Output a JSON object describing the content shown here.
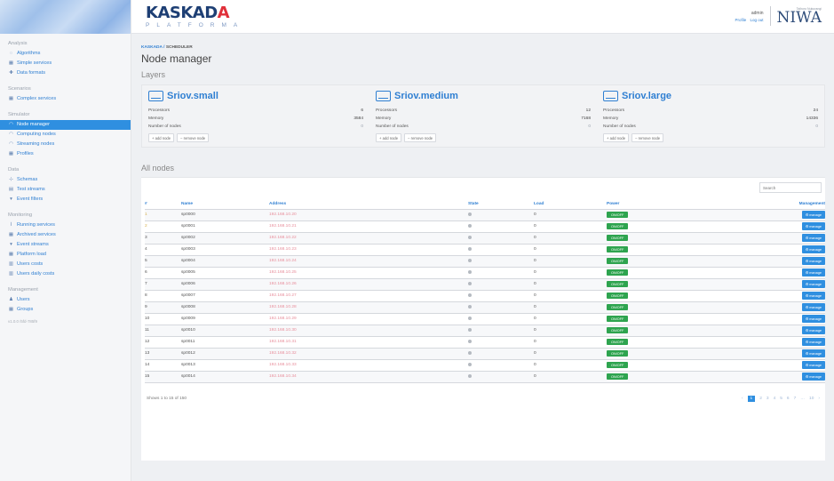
{
  "sidebar": {
    "sections": [
      {
        "title": "Analysis",
        "items": [
          {
            "icon": "spiral-icon",
            "glyph": "◌",
            "label": "Algorithms"
          },
          {
            "icon": "grid-icon",
            "glyph": "▦",
            "label": "Simple services"
          },
          {
            "icon": "pin-icon",
            "glyph": "✚",
            "label": "Data formats"
          }
        ]
      },
      {
        "title": "Scenarios",
        "items": [
          {
            "icon": "grid-icon",
            "glyph": "▦",
            "label": "Complex services"
          }
        ]
      },
      {
        "title": "Simulator",
        "items": [
          {
            "icon": "node-icon",
            "glyph": "◠",
            "label": "Node manager",
            "active": true
          },
          {
            "icon": "node-icon",
            "glyph": "◠",
            "label": "Computing nodes"
          },
          {
            "icon": "node-icon",
            "glyph": "◠",
            "label": "Streaming nodes"
          },
          {
            "icon": "grid-icon",
            "glyph": "▦",
            "label": "Profiles"
          }
        ]
      },
      {
        "title": "Data",
        "items": [
          {
            "icon": "tree-icon",
            "glyph": "⊹",
            "label": "Schemas"
          },
          {
            "icon": "table-icon",
            "glyph": "▤",
            "label": "Test streams"
          },
          {
            "icon": "filter-icon",
            "glyph": "▾",
            "label": "Event filters"
          }
        ]
      },
      {
        "title": "Monitoring",
        "items": [
          {
            "icon": "pulse-icon",
            "glyph": "⌇",
            "label": "Running services"
          },
          {
            "icon": "archive-icon",
            "glyph": "▦",
            "label": "Archived services"
          },
          {
            "icon": "filter-icon",
            "glyph": "▾",
            "label": "Event streams"
          },
          {
            "icon": "grid-icon",
            "glyph": "▦",
            "label": "Platform load"
          },
          {
            "icon": "bar-chart-icon",
            "glyph": "▥",
            "label": "Users costs"
          },
          {
            "icon": "bar-chart-icon",
            "glyph": "▥",
            "label": "Users daily costs"
          }
        ]
      },
      {
        "title": "Management",
        "items": [
          {
            "icon": "user-icon",
            "glyph": "♟",
            "label": "Users"
          },
          {
            "icon": "group-icon",
            "glyph": "▦",
            "label": "Groups"
          }
        ]
      }
    ],
    "version": "v1.0.0 /5fd-785f9"
  },
  "header": {
    "logo_word_main": "KASKAD",
    "logo_word_accent": "A",
    "logo_sub": "PLATFORMA",
    "user_name": "admin",
    "user_link_1": "Profile",
    "user_link_2": "Log out",
    "partner": "NIWA",
    "partner_sub": "Taihoro Nukurangi"
  },
  "main": {
    "breadcrumb": {
      "root": "KASKADA",
      "current": "SCHEDULER"
    },
    "title": "Node manager",
    "layers_title": "Layers",
    "layers": [
      {
        "name": "Sriov.small",
        "processors": "6",
        "memory": "3584",
        "nodes": "0"
      },
      {
        "name": "Sriov.medium",
        "processors": "12",
        "memory": "7168",
        "nodes": "0"
      },
      {
        "name": "Sriov.large",
        "processors": "24",
        "memory": "14336",
        "nodes": "0"
      }
    ],
    "layer_labels": {
      "processors": "Processors",
      "memory": "Memory",
      "nodes": "Number of nodes",
      "add": "+ add node",
      "remove": "− remove node"
    },
    "all_nodes_title": "All nodes",
    "search_placeholder": "Search",
    "columns": {
      "idx": "#",
      "name": "Name",
      "address": "Address",
      "state": "State",
      "load": "Load",
      "power": "Power",
      "management": "Management"
    },
    "power_label": "ON/OFF",
    "manage_label": "⚙ manage",
    "rows": [
      {
        "idx": "1",
        "name": "sp0000",
        "address": "192.168.10.20",
        "load": "0",
        "hl": true
      },
      {
        "idx": "2",
        "name": "sp0001",
        "address": "192.168.10.21",
        "load": "0",
        "hl": true
      },
      {
        "idx": "3",
        "name": "sp0002",
        "address": "192.168.10.22",
        "load": "0"
      },
      {
        "idx": "4",
        "name": "sp0003",
        "address": "192.168.10.23",
        "load": "0"
      },
      {
        "idx": "5",
        "name": "sp0004",
        "address": "192.168.10.24",
        "load": "0"
      },
      {
        "idx": "6",
        "name": "sp0005",
        "address": "192.168.10.25",
        "load": "0"
      },
      {
        "idx": "7",
        "name": "sp0006",
        "address": "192.168.10.26",
        "load": "0"
      },
      {
        "idx": "8",
        "name": "sp0007",
        "address": "192.168.10.27",
        "load": "0"
      },
      {
        "idx": "9",
        "name": "sp0008",
        "address": "192.168.10.28",
        "load": "0"
      },
      {
        "idx": "10",
        "name": "sp0009",
        "address": "192.168.10.29",
        "load": "0"
      },
      {
        "idx": "11",
        "name": "sp0010",
        "address": "192.168.10.30",
        "load": "0"
      },
      {
        "idx": "12",
        "name": "sp0011",
        "address": "192.168.10.31",
        "load": "0"
      },
      {
        "idx": "13",
        "name": "sp0012",
        "address": "192.168.10.32",
        "load": "0"
      },
      {
        "idx": "14",
        "name": "sp0013",
        "address": "192.168.10.33",
        "load": "0"
      },
      {
        "idx": "15",
        "name": "sp0014",
        "address": "192.168.10.34",
        "load": "0"
      }
    ],
    "showing": "Shows 1 to 15 of 150",
    "pager": {
      "prev": "‹",
      "pages": [
        "1",
        "2",
        "3",
        "4",
        "5",
        "6",
        "7"
      ],
      "ellipsis": "…",
      "last": "10",
      "next": "›"
    }
  }
}
